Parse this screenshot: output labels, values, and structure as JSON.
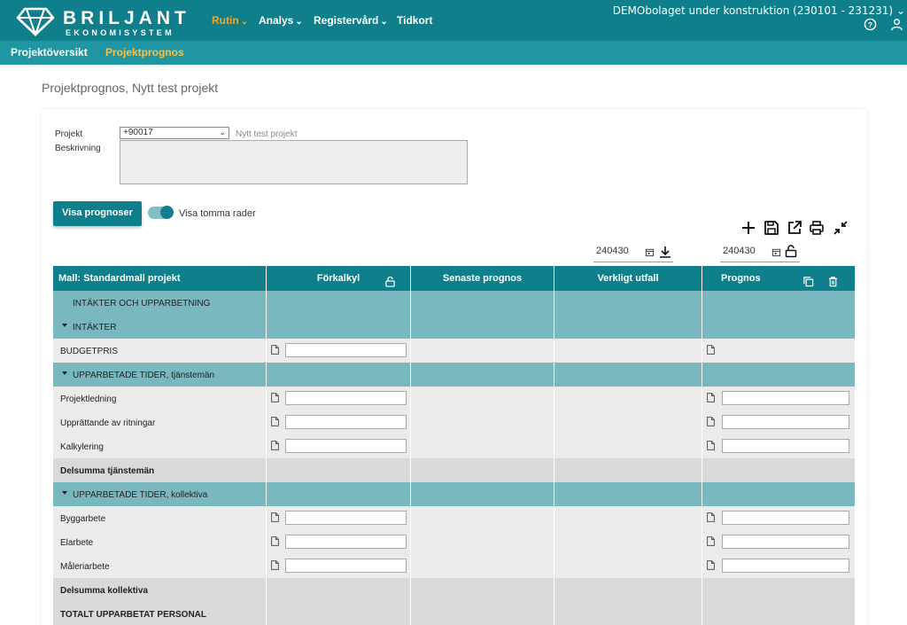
{
  "brand": {
    "name": "BRILJANT",
    "sub": "EKONOMISYSTEM"
  },
  "nav": [
    {
      "label": "Rutin",
      "caret": true
    },
    {
      "label": "Analys",
      "caret": true
    },
    {
      "label": "Registervård",
      "caret": true
    },
    {
      "label": "Tidkort",
      "caret": false
    }
  ],
  "company": "DEMObolaget under konstruktion (230101 - 231231)",
  "subnav": [
    "Projektöversikt",
    "Projektprognos"
  ],
  "page_title": "Projektprognos, Nytt test projekt",
  "form": {
    "projekt_label": "Projekt",
    "projekt_value": "+90017",
    "projekt_name": "Nytt test projekt",
    "beskrivning_label": "Beskrivning",
    "beskrivning_value": ""
  },
  "actions": {
    "show_button": "Visa prognoser",
    "toggle_label": "Visa tomma rader",
    "toggle_on": true
  },
  "dates": {
    "left": "240430",
    "right": "240430"
  },
  "toolbar_icons": [
    "plus-icon",
    "save-icon",
    "export-icon",
    "print-icon",
    "collapse-icon"
  ],
  "table": {
    "headers": [
      "Mall: Standardmall projekt",
      "Förkalkyl",
      "Senaste prognos",
      "Verkligt utfall",
      "Prognos"
    ],
    "rows": [
      {
        "type": "sec",
        "label": "INTÄKTER OCH UPPARBETNING"
      },
      {
        "type": "sub",
        "label": "INTÄKTER"
      },
      {
        "type": "data",
        "label": "BUDGETPRIS",
        "prognos_input": false
      },
      {
        "type": "sub",
        "label": "UPPARBETADE TIDER, tjänstemän"
      },
      {
        "type": "data",
        "label": "Projektledning",
        "prognos_input": true
      },
      {
        "type": "data",
        "label": "Upprättande av ritningar",
        "prognos_input": true
      },
      {
        "type": "data",
        "label": "Kalkylering",
        "prognos_input": true
      },
      {
        "type": "sum",
        "label": "Delsumma tjänstemän"
      },
      {
        "type": "sub",
        "label": "UPPARBETADE TIDER, kollektiva"
      },
      {
        "type": "data",
        "label": "Byggarbete",
        "prognos_input": true
      },
      {
        "type": "data",
        "label": "Elarbete",
        "prognos_input": true
      },
      {
        "type": "data",
        "label": "Måleriarbete",
        "prognos_input": true
      },
      {
        "type": "sum",
        "label": "Delsumma kollektiva"
      },
      {
        "type": "sum",
        "label": "TOTALT UPPARBETAT PERSONAL"
      }
    ]
  },
  "colors": {
    "primary": "#0e7f8b",
    "subbar": "#2196a3",
    "accent": "#f5a623",
    "section": "#7ab8bf"
  }
}
